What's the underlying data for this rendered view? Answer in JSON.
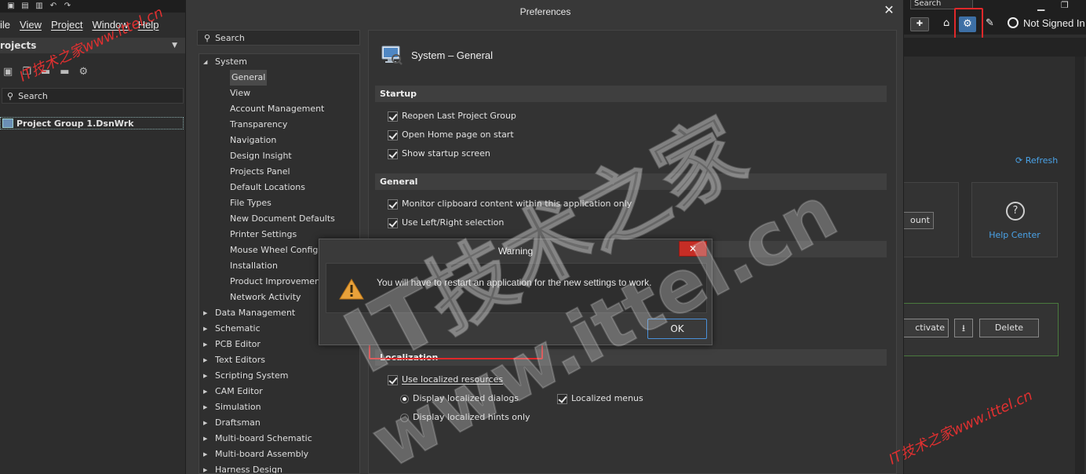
{
  "left_app": {
    "menu": [
      "ile",
      "View",
      "Project",
      "Window",
      "Help"
    ],
    "panel_title": "rojects",
    "search_placeholder": "Search",
    "project_item": "Project Group 1.DsnWrk"
  },
  "right_app": {
    "search_text": "Search",
    "user_label": "Not Signed In",
    "refresh_label": "Refresh",
    "account_button": "ount",
    "help_center": "Help Center",
    "help_icon_glyph": "?",
    "activate_button": "ctivate",
    "delete_button": "Delete"
  },
  "preferences": {
    "title": "Preferences",
    "close_glyph": "✕",
    "search_placeholder": "Search",
    "tree": [
      {
        "label": "System",
        "expanded": true,
        "level": 0
      },
      {
        "label": "General",
        "level": 1,
        "selected": true
      },
      {
        "label": "View",
        "level": 1
      },
      {
        "label": "Account Management",
        "level": 1
      },
      {
        "label": "Transparency",
        "level": 1
      },
      {
        "label": "Navigation",
        "level": 1
      },
      {
        "label": "Design Insight",
        "level": 1
      },
      {
        "label": "Projects Panel",
        "level": 1
      },
      {
        "label": "Default Locations",
        "level": 1
      },
      {
        "label": "File Types",
        "level": 1
      },
      {
        "label": "New Document Defaults",
        "level": 1
      },
      {
        "label": "Printer Settings",
        "level": 1
      },
      {
        "label": "Mouse Wheel Configu",
        "level": 1
      },
      {
        "label": "Installation",
        "level": 1
      },
      {
        "label": "Product Improvement",
        "level": 1
      },
      {
        "label": "Network Activity",
        "level": 1
      },
      {
        "label": "Data Management",
        "level": 0
      },
      {
        "label": "Schematic",
        "level": 0
      },
      {
        "label": "PCB Editor",
        "level": 0
      },
      {
        "label": "Text Editors",
        "level": 0
      },
      {
        "label": "Scripting System",
        "level": 0
      },
      {
        "label": "CAM Editor",
        "level": 0
      },
      {
        "label": "Simulation",
        "level": 0
      },
      {
        "label": "Draftsman",
        "level": 0
      },
      {
        "label": "Multi-board Schematic",
        "level": 0
      },
      {
        "label": "Multi-board Assembly",
        "level": 0
      },
      {
        "label": "Harness Design",
        "level": 0
      }
    ],
    "content": {
      "title": "System – General",
      "startup": {
        "header": "Startup",
        "reopen": "Reopen Last Project Group",
        "open_home": "Open Home page on start",
        "show_startup": "Show startup screen"
      },
      "general": {
        "header": "General",
        "clipboard": "Monitor clipboard content within this application only",
        "left_right": "Use Left/Right selection"
      },
      "localization": {
        "header": "Localization",
        "use_localized": "Use localized resources",
        "display_dialogs": "Display localized dialogs",
        "localized_menus": "Localized menus",
        "display_hints": "Display localized hints only"
      }
    }
  },
  "warning": {
    "title": "Warning",
    "message": "You will have to restart an application for the new settings to work.",
    "ok": "OK",
    "close_glyph": "✕"
  },
  "watermarks": {
    "small": "IT技术之家www.ittel.cn",
    "big_line1": "IT技术之家",
    "big_line2": "www.ittel.cn"
  },
  "colors": {
    "accent_blue": "#4aa3e8",
    "highlight_red": "#e0282a",
    "warn_close": "#c62d25",
    "selected_gear": "#3d6fa5"
  }
}
